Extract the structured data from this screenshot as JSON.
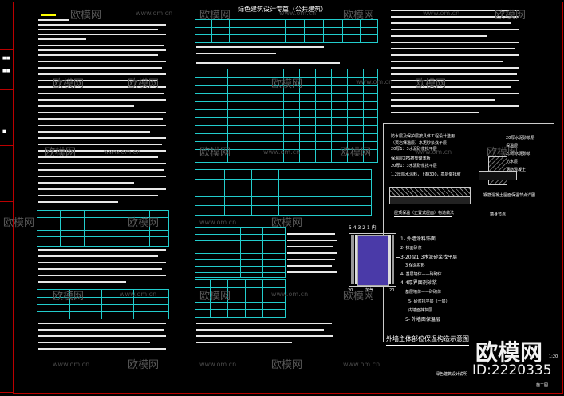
{
  "title": "绿色建筑设计专篇（公共建筑）",
  "watermark": {
    "brand": "欧模网",
    "url": "www.om.cn",
    "id_label": "ID:2220335"
  },
  "detail": {
    "caption_top": "屋顶保温（正置式屋面）构造做法",
    "roof_layers": [
      "防水层及保护层按具体工程设计选用",
      "（页岩保温层）水泥砂浆找平层",
      "20厚1：3水泥砂浆找平层",
      "保温层XPS挤塑聚苯板",
      "20厚1：3水泥砂浆找平层",
      "1.2厚防水涂料，上翻300，基层做找坡"
    ],
    "right_block_text": [
      "20厚水泥砂浆层",
      "保温层",
      "20厚水泥砂浆",
      "防水层",
      "钢筋混凝土"
    ],
    "right_caption": "钢筋混凝土屋面保温节点详图",
    "right_caption_2": "墙身节点",
    "wall_dims": "5 4 3 2 1 内",
    "wall_layers": [
      "1- 外墙涂料饰面",
      "2- 抹面砂浆",
      "3-20厚1:3水泥砂浆找平层",
      "3 保温材料",
      "4- 基层墙体——砖砌体",
      "4-4厚界面剂砂浆",
      "基层墙体——砖砌体",
      "5- 砂浆找平层（一层）",
      "内墙面抹灰层",
      "5- 外墙面保温层"
    ],
    "wall_bottom_dims": [
      "20",
      "加气",
      "20"
    ],
    "main_caption": "外墙主体部位保温构造示意图",
    "scale_label": "1:20",
    "sheet_label": "绿色建筑设计说明",
    "sheet_no": "施工图"
  },
  "colors": {
    "frame": "#bb0000",
    "grid": "#22cccc",
    "text": "#e8e8e8",
    "accent": "#ffff00"
  }
}
